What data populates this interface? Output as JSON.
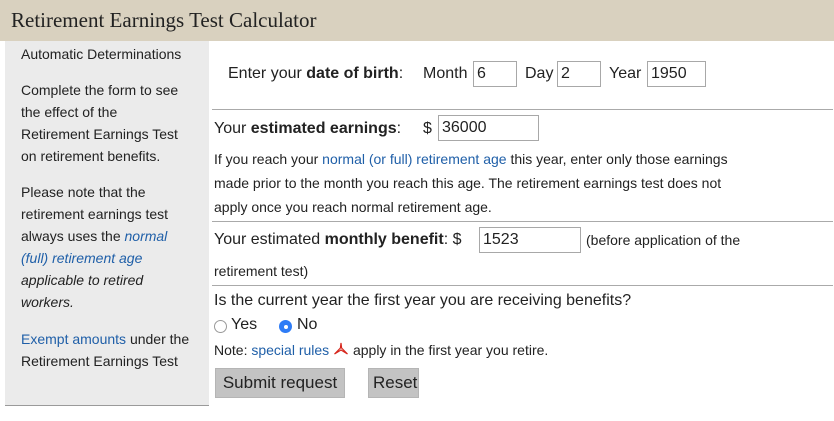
{
  "title": "Retirement Earnings Test Calculator",
  "sidebar": {
    "heading": "Automatic Determinations",
    "intro_lines": [
      "Complete the form to see",
      "the effect of the",
      "Retirement Earnings Test",
      "on retirement benefits."
    ],
    "note_lines": [
      "Please note that the",
      "retirement earnings test",
      "always uses the"
    ],
    "note_link_1": "normal",
    "note_link_2": "(full) retirement age",
    "note_italic_1": "applicable to retired",
    "note_italic_2": "workers.",
    "exempt_link": "Exempt amounts",
    "exempt_text_1": " under the",
    "exempt_text_2": "Retirement Earnings Test"
  },
  "dob": {
    "prefix": "Enter your ",
    "bold": "date of birth",
    "suffix": ":",
    "month_label": "Month",
    "month_value": "6",
    "day_label": "Day",
    "day_value": "2",
    "year_label": "Year",
    "year_value": "1950"
  },
  "earnings": {
    "prefix": "Your ",
    "bold": "estimated earnings",
    "suffix": ":",
    "currency": "$",
    "value": "36000",
    "help_1": "If you reach your ",
    "help_link": "normal (or full) retirement age",
    "help_2": " this year, enter only those earnings",
    "help_3": "made prior to the month you reach this age. The retirement earnings test does not",
    "help_4": "apply once you reach normal retirement age."
  },
  "benefit": {
    "prefix": "Your estimated ",
    "bold": "monthly benefit",
    "suffix": ":",
    "currency": "$",
    "value": "1523",
    "note_1": "(before application of the",
    "note_2": "retirement test)"
  },
  "first_year": {
    "question": "Is the current year the first year you are receiving benefits?",
    "option_yes": "Yes",
    "option_no": "No",
    "selected": "No",
    "note_prefix": "Note: ",
    "note_link": "special rules",
    "note_suffix": " apply in the first year you retire."
  },
  "buttons": {
    "submit": "Submit request",
    "reset": "Reset"
  },
  "colors": {
    "title_bar": "#d9d1bf",
    "sidebar_bg": "#ebebeb",
    "link": "#1f5fa8",
    "heading_red": "#a31f2a",
    "radio_selected": "#2e7cf6",
    "button_bg": "#c3c3c3"
  },
  "icons": {
    "pdf": "pdf-icon"
  }
}
